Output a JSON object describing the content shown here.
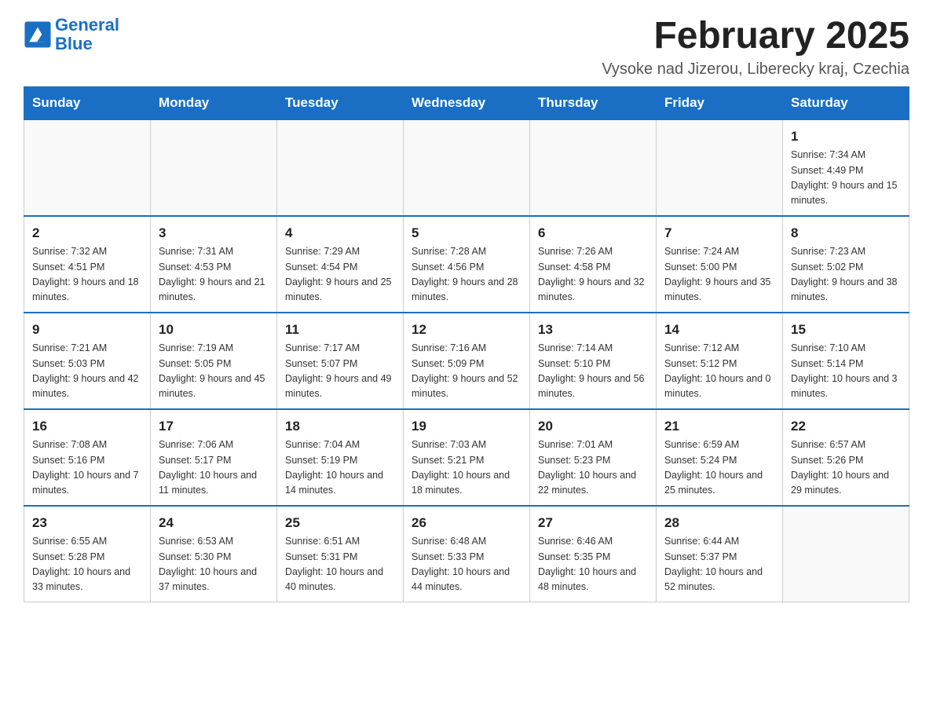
{
  "header": {
    "logo_general": "General",
    "logo_blue": "Blue",
    "month_title": "February 2025",
    "location": "Vysoke nad Jizerou, Liberecky kraj, Czechia"
  },
  "days_of_week": [
    "Sunday",
    "Monday",
    "Tuesday",
    "Wednesday",
    "Thursday",
    "Friday",
    "Saturday"
  ],
  "weeks": [
    [
      {
        "day": "",
        "info": ""
      },
      {
        "day": "",
        "info": ""
      },
      {
        "day": "",
        "info": ""
      },
      {
        "day": "",
        "info": ""
      },
      {
        "day": "",
        "info": ""
      },
      {
        "day": "",
        "info": ""
      },
      {
        "day": "1",
        "info": "Sunrise: 7:34 AM\nSunset: 4:49 PM\nDaylight: 9 hours and 15 minutes."
      }
    ],
    [
      {
        "day": "2",
        "info": "Sunrise: 7:32 AM\nSunset: 4:51 PM\nDaylight: 9 hours and 18 minutes."
      },
      {
        "day": "3",
        "info": "Sunrise: 7:31 AM\nSunset: 4:53 PM\nDaylight: 9 hours and 21 minutes."
      },
      {
        "day": "4",
        "info": "Sunrise: 7:29 AM\nSunset: 4:54 PM\nDaylight: 9 hours and 25 minutes."
      },
      {
        "day": "5",
        "info": "Sunrise: 7:28 AM\nSunset: 4:56 PM\nDaylight: 9 hours and 28 minutes."
      },
      {
        "day": "6",
        "info": "Sunrise: 7:26 AM\nSunset: 4:58 PM\nDaylight: 9 hours and 32 minutes."
      },
      {
        "day": "7",
        "info": "Sunrise: 7:24 AM\nSunset: 5:00 PM\nDaylight: 9 hours and 35 minutes."
      },
      {
        "day": "8",
        "info": "Sunrise: 7:23 AM\nSunset: 5:02 PM\nDaylight: 9 hours and 38 minutes."
      }
    ],
    [
      {
        "day": "9",
        "info": "Sunrise: 7:21 AM\nSunset: 5:03 PM\nDaylight: 9 hours and 42 minutes."
      },
      {
        "day": "10",
        "info": "Sunrise: 7:19 AM\nSunset: 5:05 PM\nDaylight: 9 hours and 45 minutes."
      },
      {
        "day": "11",
        "info": "Sunrise: 7:17 AM\nSunset: 5:07 PM\nDaylight: 9 hours and 49 minutes."
      },
      {
        "day": "12",
        "info": "Sunrise: 7:16 AM\nSunset: 5:09 PM\nDaylight: 9 hours and 52 minutes."
      },
      {
        "day": "13",
        "info": "Sunrise: 7:14 AM\nSunset: 5:10 PM\nDaylight: 9 hours and 56 minutes."
      },
      {
        "day": "14",
        "info": "Sunrise: 7:12 AM\nSunset: 5:12 PM\nDaylight: 10 hours and 0 minutes."
      },
      {
        "day": "15",
        "info": "Sunrise: 7:10 AM\nSunset: 5:14 PM\nDaylight: 10 hours and 3 minutes."
      }
    ],
    [
      {
        "day": "16",
        "info": "Sunrise: 7:08 AM\nSunset: 5:16 PM\nDaylight: 10 hours and 7 minutes."
      },
      {
        "day": "17",
        "info": "Sunrise: 7:06 AM\nSunset: 5:17 PM\nDaylight: 10 hours and 11 minutes."
      },
      {
        "day": "18",
        "info": "Sunrise: 7:04 AM\nSunset: 5:19 PM\nDaylight: 10 hours and 14 minutes."
      },
      {
        "day": "19",
        "info": "Sunrise: 7:03 AM\nSunset: 5:21 PM\nDaylight: 10 hours and 18 minutes."
      },
      {
        "day": "20",
        "info": "Sunrise: 7:01 AM\nSunset: 5:23 PM\nDaylight: 10 hours and 22 minutes."
      },
      {
        "day": "21",
        "info": "Sunrise: 6:59 AM\nSunset: 5:24 PM\nDaylight: 10 hours and 25 minutes."
      },
      {
        "day": "22",
        "info": "Sunrise: 6:57 AM\nSunset: 5:26 PM\nDaylight: 10 hours and 29 minutes."
      }
    ],
    [
      {
        "day": "23",
        "info": "Sunrise: 6:55 AM\nSunset: 5:28 PM\nDaylight: 10 hours and 33 minutes."
      },
      {
        "day": "24",
        "info": "Sunrise: 6:53 AM\nSunset: 5:30 PM\nDaylight: 10 hours and 37 minutes."
      },
      {
        "day": "25",
        "info": "Sunrise: 6:51 AM\nSunset: 5:31 PM\nDaylight: 10 hours and 40 minutes."
      },
      {
        "day": "26",
        "info": "Sunrise: 6:48 AM\nSunset: 5:33 PM\nDaylight: 10 hours and 44 minutes."
      },
      {
        "day": "27",
        "info": "Sunrise: 6:46 AM\nSunset: 5:35 PM\nDaylight: 10 hours and 48 minutes."
      },
      {
        "day": "28",
        "info": "Sunrise: 6:44 AM\nSunset: 5:37 PM\nDaylight: 10 hours and 52 minutes."
      },
      {
        "day": "",
        "info": ""
      }
    ]
  ]
}
